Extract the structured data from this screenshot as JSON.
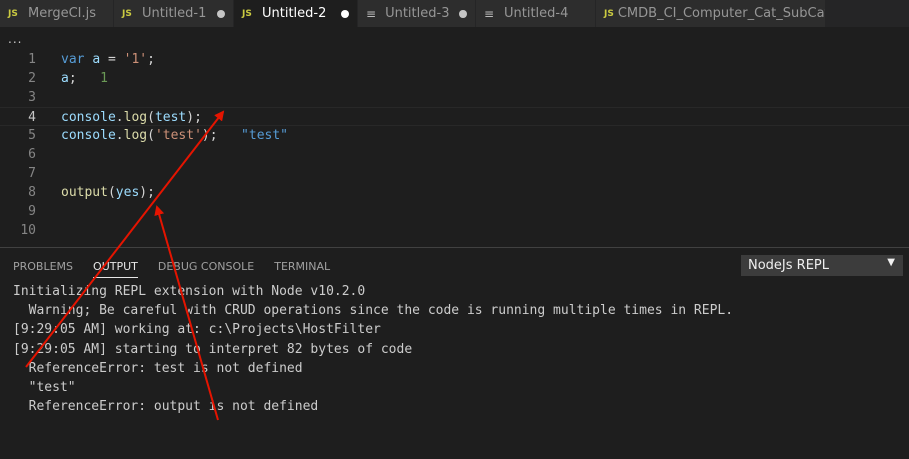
{
  "tabs": [
    {
      "icon": "JS",
      "kind": "js",
      "label": "MergeCI.js",
      "dirty": false,
      "active": false
    },
    {
      "icon": "JS",
      "kind": "js",
      "label": "Untitled-1",
      "dirty": true,
      "active": false
    },
    {
      "icon": "JS",
      "kind": "js",
      "label": "Untitled-2",
      "dirty": true,
      "active": true
    },
    {
      "icon": "≡",
      "kind": "txt",
      "label": "Untitled-3",
      "dirty": true,
      "active": false
    },
    {
      "icon": "≡",
      "kind": "txt",
      "label": "Untitled-4",
      "dirty": false,
      "active": false
    },
    {
      "icon": "JS",
      "kind": "js",
      "label": "CMDB_CI_Computer_Cat_SubCat_set.js",
      "dirty": true,
      "active": false
    }
  ],
  "breadcrumb": "...",
  "editor": {
    "lines": [
      {
        "n": "1",
        "code": [
          {
            "t": "var",
            "c": "kw"
          },
          {
            "t": " ",
            "c": "pl"
          },
          {
            "t": "a",
            "c": "vr"
          },
          {
            "t": " = ",
            "c": "pl"
          },
          {
            "t": "'1'",
            "c": "st"
          },
          {
            "t": ";",
            "c": "pl"
          }
        ]
      },
      {
        "n": "2",
        "code": [
          {
            "t": "a",
            "c": "vr"
          },
          {
            "t": ";   ",
            "c": "pl"
          },
          {
            "t": "1",
            "c": "res-num"
          }
        ]
      },
      {
        "n": "3",
        "code": []
      },
      {
        "n": "4",
        "active": true,
        "code": [
          {
            "t": "console",
            "c": "vr"
          },
          {
            "t": ".",
            "c": "pl"
          },
          {
            "t": "log",
            "c": "fn"
          },
          {
            "t": "(",
            "c": "pl"
          },
          {
            "t": "test",
            "c": "vr"
          },
          {
            "t": ");",
            "c": "pl"
          }
        ]
      },
      {
        "n": "5",
        "code": [
          {
            "t": "console",
            "c": "vr"
          },
          {
            "t": ".",
            "c": "pl"
          },
          {
            "t": "log",
            "c": "fn"
          },
          {
            "t": "(",
            "c": "pl"
          },
          {
            "t": "'test'",
            "c": "st"
          },
          {
            "t": ");   ",
            "c": "pl"
          },
          {
            "t": "\"test\"",
            "c": "res-str"
          }
        ]
      },
      {
        "n": "6",
        "code": []
      },
      {
        "n": "7",
        "code": []
      },
      {
        "n": "8",
        "code": [
          {
            "t": "output",
            "c": "fn"
          },
          {
            "t": "(",
            "c": "pl"
          },
          {
            "t": "yes",
            "c": "vr"
          },
          {
            "t": ");",
            "c": "pl"
          }
        ]
      },
      {
        "n": "9",
        "code": []
      },
      {
        "n": "10",
        "code": []
      }
    ]
  },
  "panel": {
    "tabs": [
      "PROBLEMS",
      "OUTPUT",
      "DEBUG CONSOLE",
      "TERMINAL"
    ],
    "active_tab": "OUTPUT",
    "channel": "NodeJs REPL",
    "output": [
      "Initializing REPL extension with Node v10.2.0",
      "  Warning; Be careful with CRUD operations since the code is running multiple times in REPL.",
      "[9:29:05 AM] working at: c:\\Projects\\HostFilter",
      "[9:29:05 AM] starting to interpret 82 bytes of code",
      "  ReferenceError: test is not defined",
      "  \"test\"",
      "  ReferenceError: output is not defined"
    ]
  },
  "annotation_color": "#e51400"
}
